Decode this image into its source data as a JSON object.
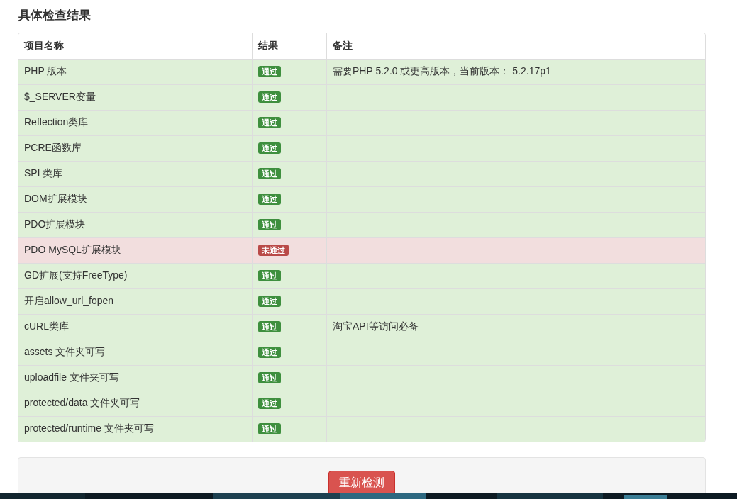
{
  "heading": "具体检查结果",
  "table": {
    "columns": [
      "项目名称",
      "结果",
      "备注"
    ],
    "rows": [
      {
        "name": "PHP 版本",
        "passed": true,
        "result": "通过",
        "note": "需要PHP 5.2.0 或更高版本，当前版本： 5.2.17p1"
      },
      {
        "name": "$_SERVER变量",
        "passed": true,
        "result": "通过"
      },
      {
        "name": "Reflection类库",
        "passed": true,
        "result": "通过"
      },
      {
        "name": "PCRE函数库",
        "passed": true,
        "result": "通过"
      },
      {
        "name": "SPL类库",
        "passed": true,
        "result": "通过"
      },
      {
        "name": "DOM扩展模块",
        "passed": true,
        "result": "通过"
      },
      {
        "name": "PDO扩展模块",
        "passed": true,
        "result": "通过"
      },
      {
        "name": "PDO MySQL扩展模块",
        "passed": false,
        "result": "未通过"
      },
      {
        "name": "GD扩展(支持FreeType)",
        "passed": true,
        "result": "通过"
      },
      {
        "name": "开启allow_url_fopen",
        "passed": true,
        "result": "通过"
      },
      {
        "name": "cURL类库",
        "passed": true,
        "result": "通过",
        "note": "淘宝API等访问必备"
      },
      {
        "name": "assets 文件夹可写",
        "passed": true,
        "result": "通过"
      },
      {
        "name": "uploadfile 文件夹可写",
        "passed": true,
        "result": "通过"
      },
      {
        "name": "protected/data 文件夹可写",
        "passed": true,
        "result": "通过"
      },
      {
        "name": "protected/runtime 文件夹可写",
        "passed": true,
        "result": "通过"
      }
    ]
  },
  "recheck_button": "重新检测"
}
